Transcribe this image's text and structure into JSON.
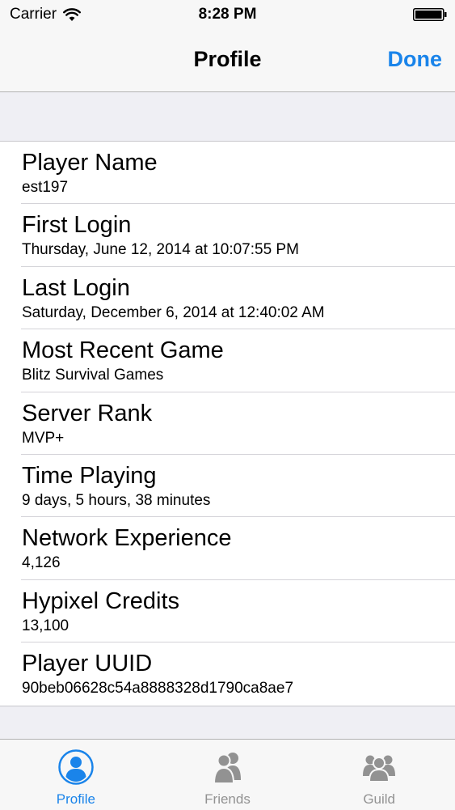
{
  "status_bar": {
    "carrier": "Carrier",
    "time": "8:28 PM"
  },
  "nav": {
    "title": "Profile",
    "done_label": "Done",
    "accent_color": "#1a84ea"
  },
  "rows": [
    {
      "title": "Player Name",
      "value": "est197"
    },
    {
      "title": "First Login",
      "value": "Thursday, June 12, 2014 at 10:07:55 PM"
    },
    {
      "title": "Last Login",
      "value": "Saturday, December 6, 2014 at 12:40:02 AM"
    },
    {
      "title": "Most Recent Game",
      "value": "Blitz Survival Games"
    },
    {
      "title": "Server Rank",
      "value": "MVP+"
    },
    {
      "title": "Time Playing",
      "value": "9 days, 5 hours, 38 minutes"
    },
    {
      "title": "Network Experience",
      "value": "4,126"
    },
    {
      "title": "Hypixel Credits",
      "value": "13,100"
    },
    {
      "title": "Player UUID",
      "value": "90beb06628c54a8888328d1790ca8ae7"
    }
  ],
  "tabs": [
    {
      "label": "Profile",
      "icon": "profile-icon",
      "active": true
    },
    {
      "label": "Friends",
      "icon": "friends-icon",
      "active": false
    },
    {
      "label": "Guild",
      "icon": "guild-icon",
      "active": false
    }
  ]
}
